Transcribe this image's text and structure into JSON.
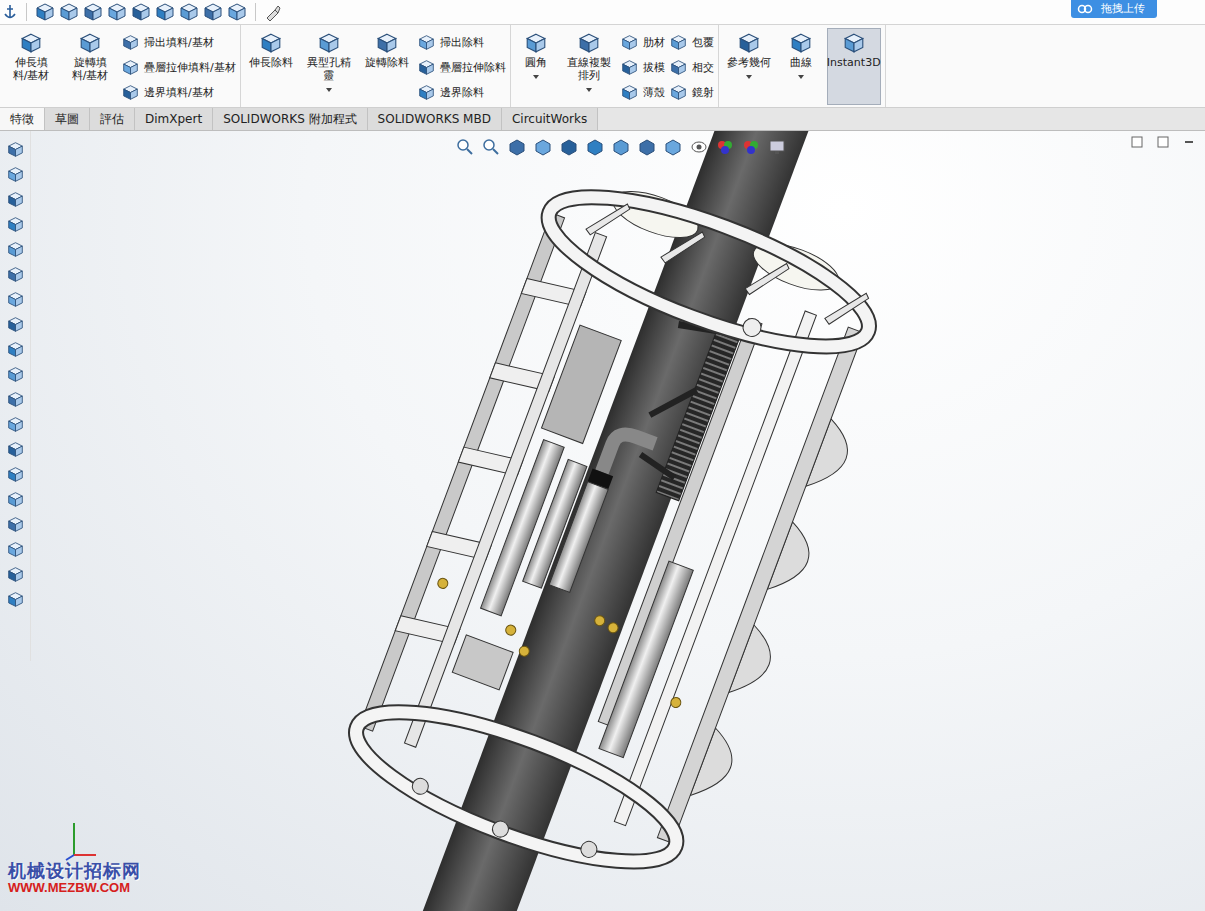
{
  "app": {
    "upload_button": "拖拽上传"
  },
  "ribbon": {
    "groups": [
      {
        "large": [
          {
            "label": "伸長填料/基材",
            "dropdown": false,
            "selected": false
          },
          {
            "label": "旋轉填料/基材",
            "dropdown": false,
            "selected": false
          }
        ],
        "small_columns": [
          [
            "掃出填料/基材",
            "疊層拉伸填料/基材",
            "邊界填料/基材"
          ]
        ]
      },
      {
        "large": [
          {
            "label": "伸長除料",
            "dropdown": false,
            "selected": false
          },
          {
            "label": "異型孔精靈",
            "dropdown": true,
            "selected": false
          },
          {
            "label": "旋轉除料",
            "dropdown": false,
            "selected": false
          }
        ],
        "small_columns": [
          [
            "掃出除料",
            "疊層拉伸除料",
            "邊界除料"
          ]
        ]
      },
      {
        "large": [
          {
            "label": "圓角",
            "dropdown": true,
            "selected": false
          },
          {
            "label": "直線複製排列",
            "dropdown": true,
            "selected": false
          }
        ],
        "small_columns": [
          [
            "肋材",
            "拔模",
            "薄殼"
          ],
          [
            "包覆",
            "相交",
            "鏡射"
          ]
        ]
      },
      {
        "large": [
          {
            "label": "參考幾何",
            "dropdown": true,
            "selected": false
          },
          {
            "label": "曲線",
            "dropdown": true,
            "selected": false
          },
          {
            "label": "Instant3D",
            "dropdown": false,
            "selected": true
          }
        ],
        "small_columns": []
      }
    ]
  },
  "tabs": [
    {
      "label": "特徵",
      "selected": true
    },
    {
      "label": "草圖",
      "selected": false
    },
    {
      "label": "評估",
      "selected": false
    },
    {
      "label": "DimXpert",
      "selected": false
    },
    {
      "label": "SOLIDWORKS 附加程式",
      "selected": false
    },
    {
      "label": "SOLIDWORKS MBD",
      "selected": false
    },
    {
      "label": "CircuitWorks",
      "selected": false
    }
  ],
  "watermark": {
    "name": "机械设计招标网",
    "url": "WWW.MEZBW.COM"
  }
}
